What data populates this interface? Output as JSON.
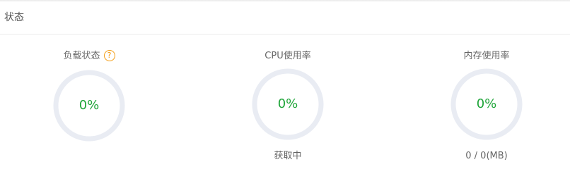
{
  "panel": {
    "title": "状态"
  },
  "metrics": [
    {
      "label": "负载状态",
      "help_icon": "question-circle-icon",
      "help_glyph": "?",
      "value": "0%",
      "percent": 0,
      "sub": ""
    },
    {
      "label": "CPU使用率",
      "value": "0%",
      "percent": 0,
      "sub": "获取中"
    },
    {
      "label": "内存使用率",
      "value": "0%",
      "percent": 0,
      "sub": "0 / 0(MB)"
    }
  ],
  "colors": {
    "ring_track": "#e9ecf3",
    "ring_fill": "#20a53a",
    "value_text": "#20a53a",
    "help_icon": "#f39c12"
  }
}
